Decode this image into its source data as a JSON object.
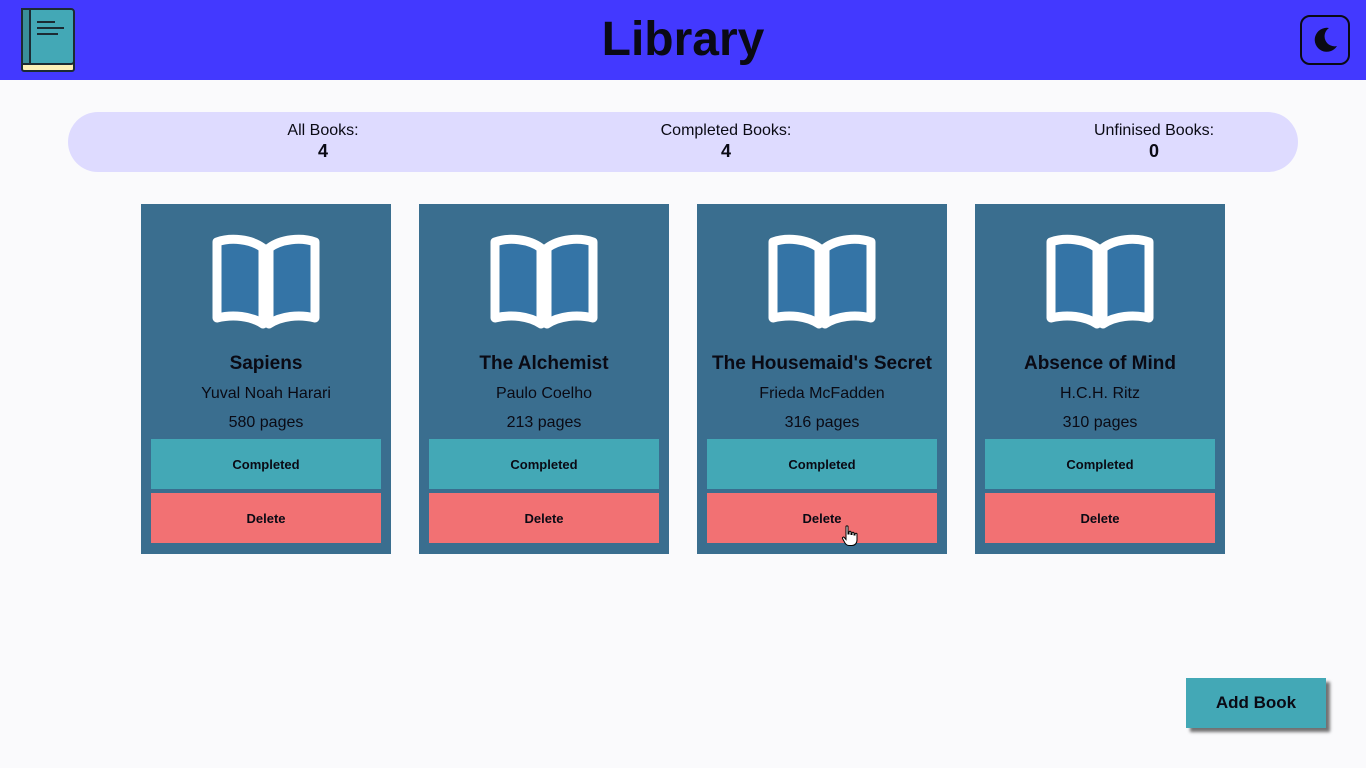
{
  "header": {
    "title": "Library",
    "logo_icon": "book-icon",
    "theme_toggle_icon": "moon-icon",
    "color": "#4339ff"
  },
  "stats": {
    "all_label": "All Books:",
    "all_value": "4",
    "completed_label": "Completed Books:",
    "completed_value": "4",
    "unfinished_label": "Unfinised Books:",
    "unfinished_value": "0"
  },
  "books": [
    {
      "title": "Sapiens",
      "author": "Yuval Noah Harari",
      "pages": "580 pages",
      "status_label": "Completed",
      "delete_label": "Delete"
    },
    {
      "title": "The Alchemist",
      "author": "Paulo Coelho",
      "pages": "213 pages",
      "status_label": "Completed",
      "delete_label": "Delete"
    },
    {
      "title": "The Housemaid's Secret",
      "author": "Frieda McFadden",
      "pages": "316 pages",
      "status_label": "Completed",
      "delete_label": "Delete"
    },
    {
      "title": "Absence of Mind",
      "author": "H.C.H. Ritz",
      "pages": "310 pages",
      "status_label": "Completed",
      "delete_label": "Delete"
    }
  ],
  "add_book_label": "Add Book",
  "colors": {
    "card": "#3a6e8f",
    "completed": "#43a8b6",
    "delete": "#f27173",
    "stats_bar": "#dedbff"
  }
}
